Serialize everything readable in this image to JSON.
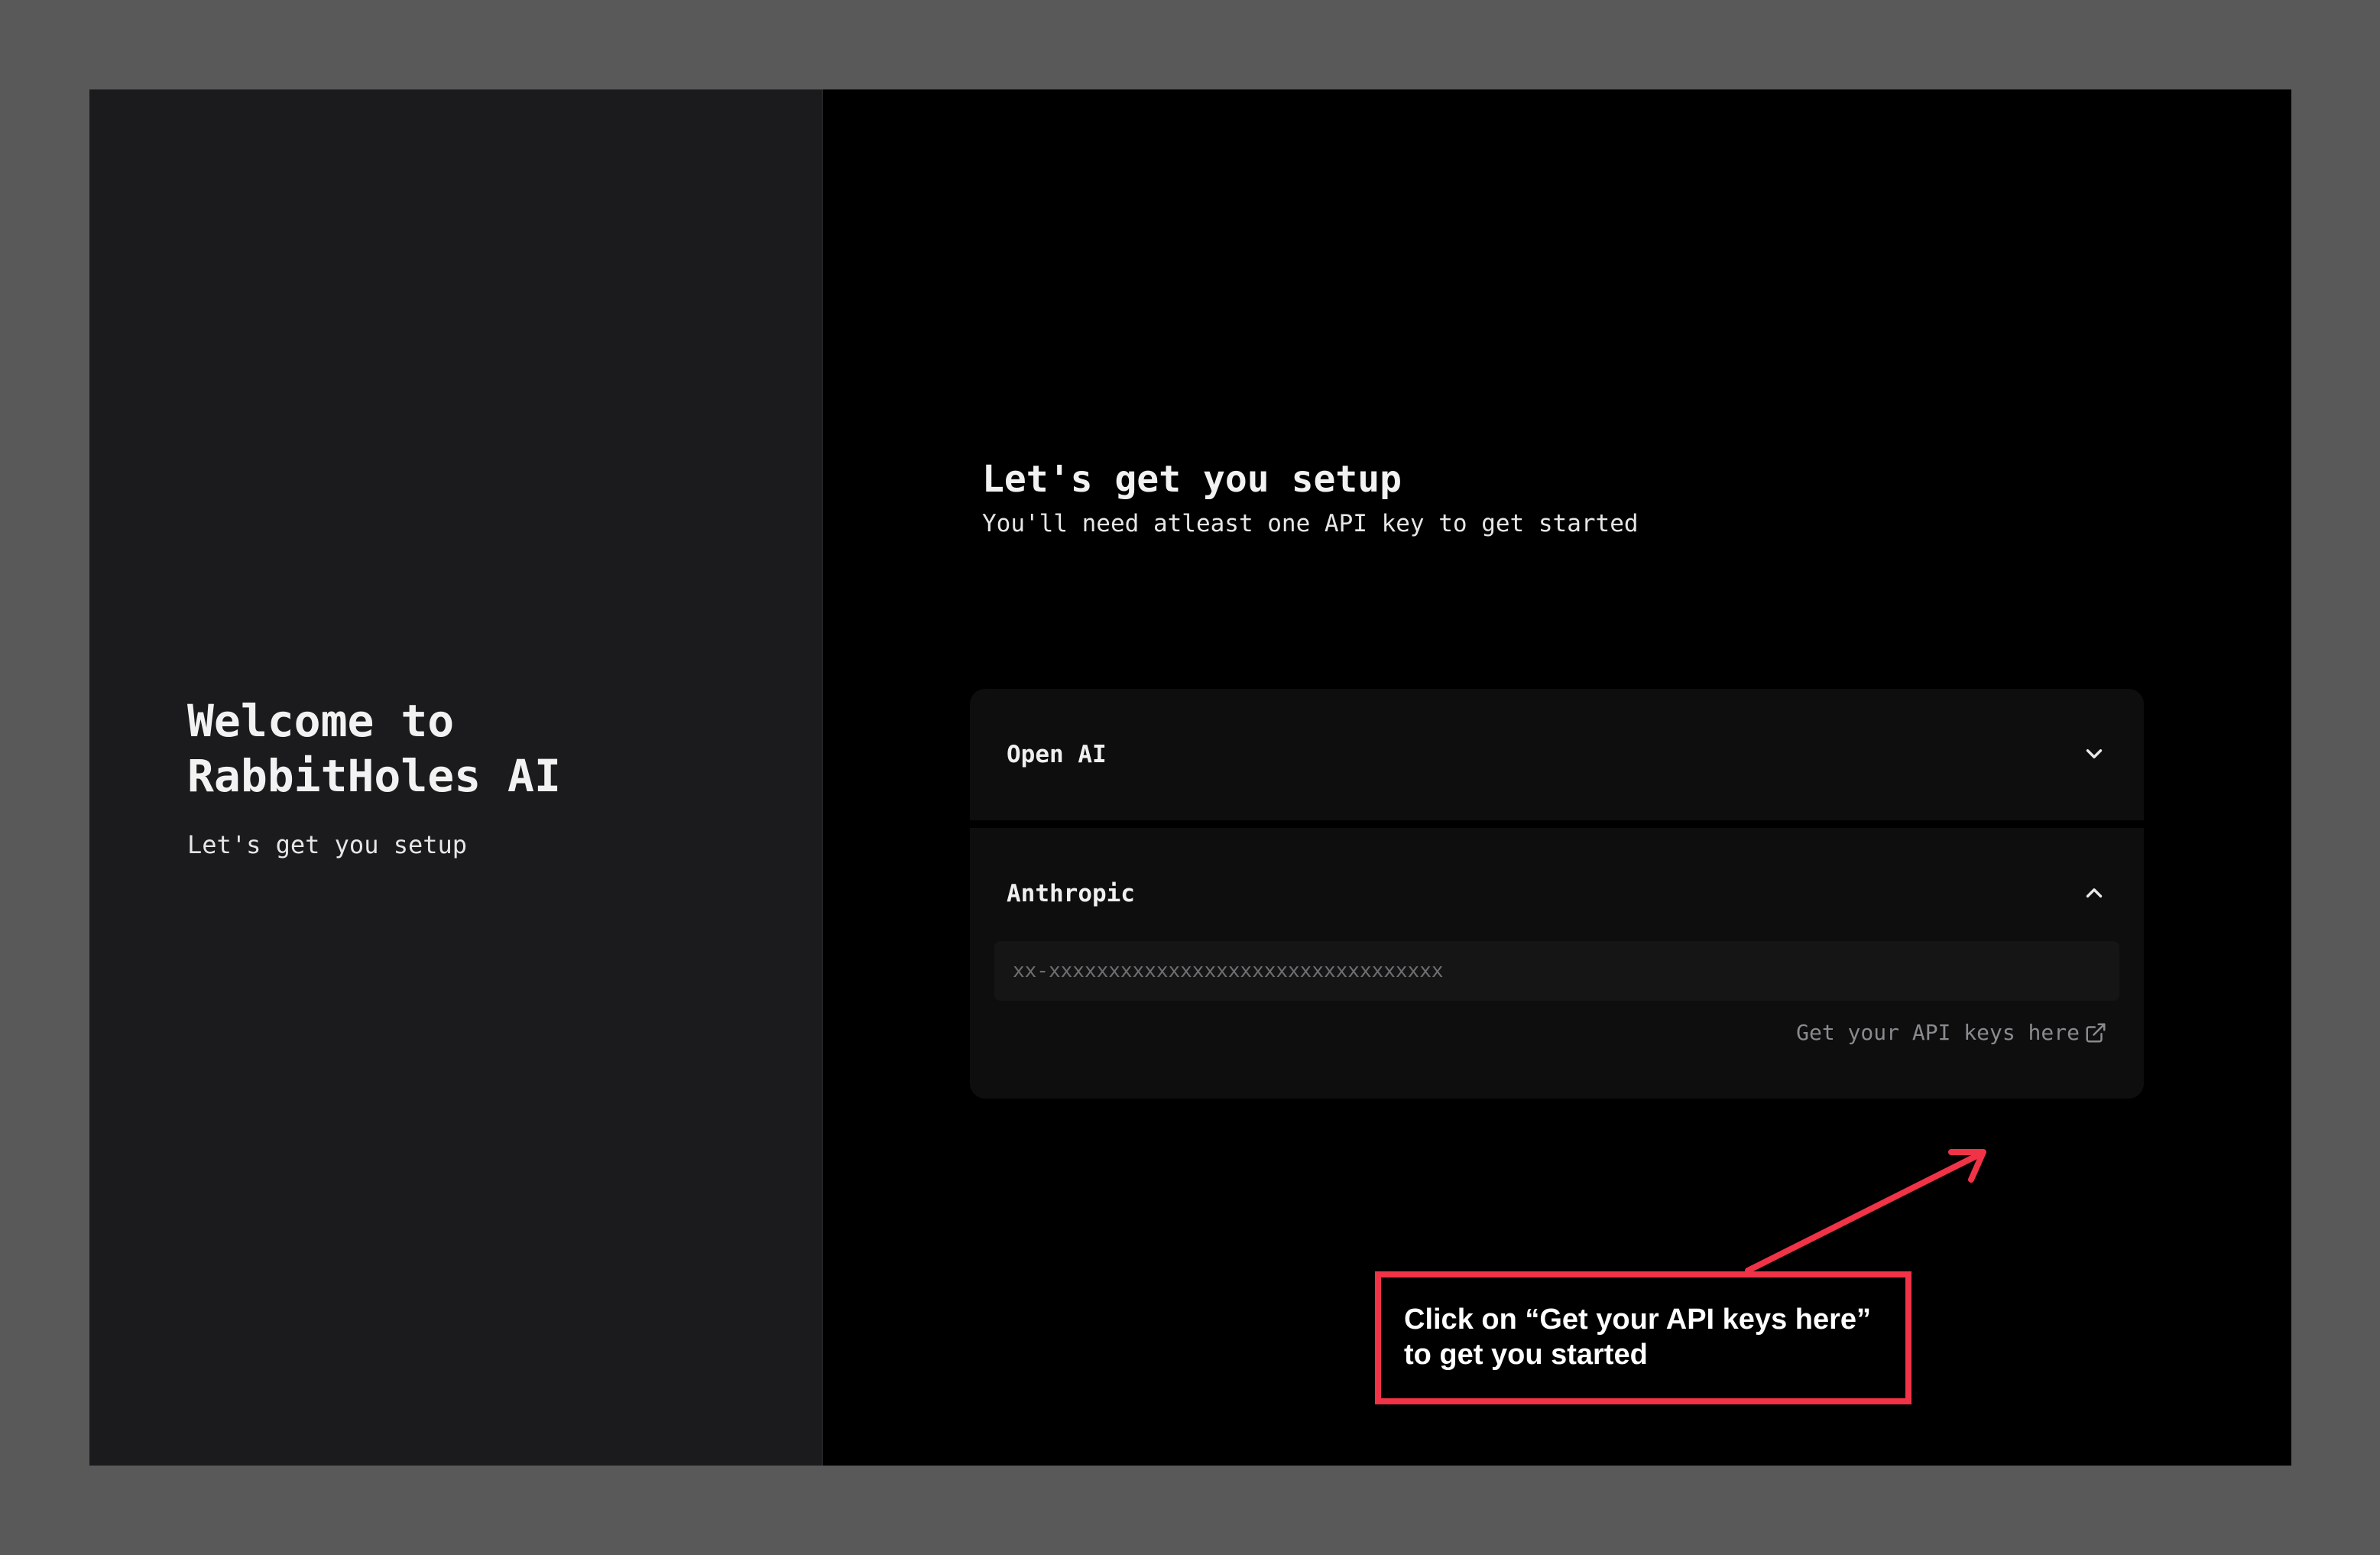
{
  "welcome": {
    "title": "Welcome to\nRabbitHoles AI",
    "subtitle": "Let's get you setup"
  },
  "setup": {
    "heading": "Let's get you setup",
    "subheading": "You'll need atleast one API key to get started"
  },
  "providers": [
    {
      "label": "Open AI",
      "expanded": false,
      "chevron_icon": "chevron-down-icon"
    },
    {
      "label": "Anthropic",
      "expanded": true,
      "chevron_icon": "chevron-up-icon",
      "input_value": "",
      "input_placeholder": "xx-xxxxxxxxxxxxxxxxxxxxxxxxxxxxxxxxx",
      "link_text": "Get your API keys here",
      "link_icon": "external-link-icon"
    }
  ],
  "annotation": {
    "text": "Click on “Get your API keys here”\nto get you started",
    "color": "#f03346"
  },
  "colors": {
    "outer_background": "#595959",
    "left_panel": "#1b1b1d",
    "right_panel": "#000000",
    "card_background": "#0e0e0f",
    "input_background": "#151516",
    "link_text": "#8a8a8e"
  }
}
